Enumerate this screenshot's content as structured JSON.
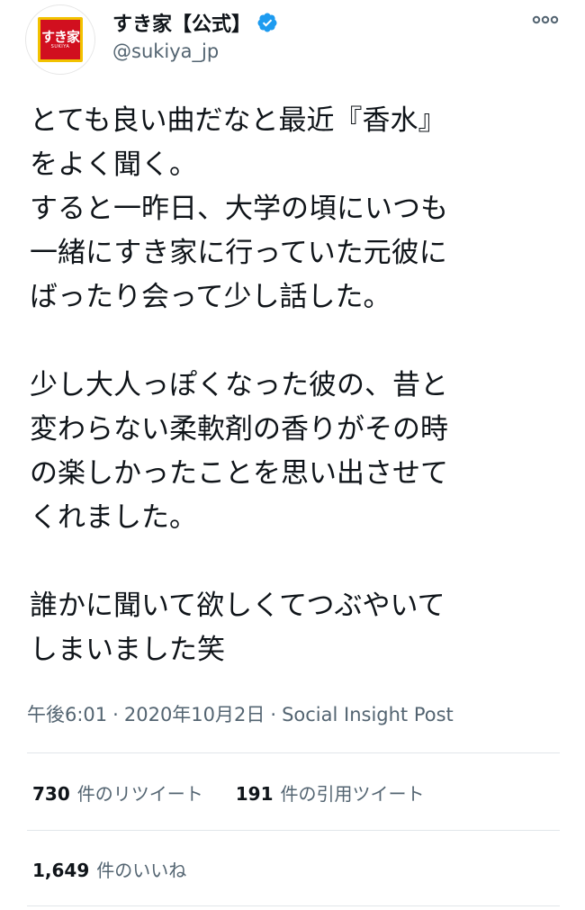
{
  "header": {
    "display_name": "すき家【公式】",
    "handle": "@sukiya_jp",
    "avatar_logo_text": "すき家",
    "avatar_logo_subtext": "SUKIYA",
    "verified_icon": "verified-badge-icon",
    "more_icon": "more-options-icon",
    "verified_color": "#1d9bf0",
    "brand_red": "#d10f1f",
    "brand_yellow": "#f2c200"
  },
  "tweet": {
    "paragraphs": [
      {
        "lines": [
          "とても良い曲だなと最近『香水』",
          "をよく聞く。",
          "すると一昨日、大学の頃にいつも",
          "一緒にすき家に行っていた元彼に",
          "ばったり会って少し話した。"
        ]
      },
      {
        "lines": [
          "少し大人っぽくなった彼の、昔と",
          "変わらない柔軟剤の香りがその時",
          "の楽しかったことを思い出させて",
          "くれました。"
        ]
      },
      {
        "lines": [
          "誰かに聞いて欲しくてつぶやいて",
          "しまいました笑"
        ]
      }
    ]
  },
  "meta": {
    "time": "午後6:01",
    "separator": "·",
    "date": "2020年10月2日",
    "source": "Social Insight Post"
  },
  "stats": {
    "retweets_count": "730",
    "retweets_label": "件のリツイート",
    "quotes_count": "191",
    "quotes_label": "件の引用ツイート",
    "likes_count": "1,649",
    "likes_label": "件のいいね"
  }
}
